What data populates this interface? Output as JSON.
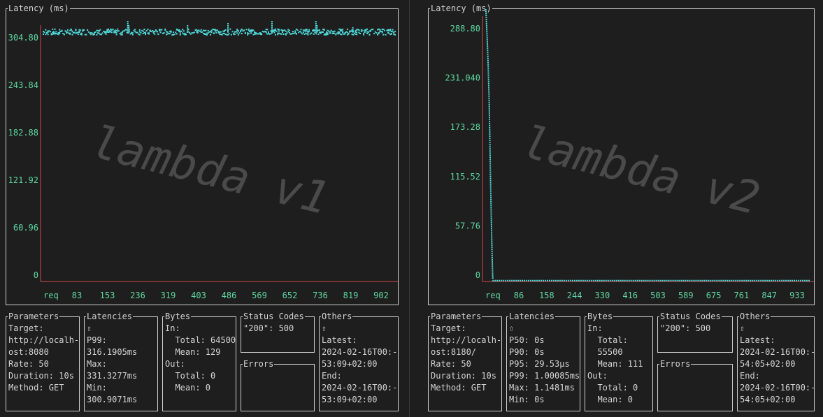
{
  "panels": [
    {
      "id": "left",
      "watermark": "lambda v1",
      "chart_title": "Latency (ms)",
      "chart_data": {
        "type": "scatter",
        "title": "Latency (ms)",
        "xlabel": "req",
        "x_ticks": [
          "83",
          "153",
          "236",
          "319",
          "403",
          "486",
          "569",
          "652",
          "736",
          "819",
          "902"
        ],
        "y_ticks": [
          "304.80",
          "243.84",
          "182.88",
          "121.92",
          "60.96",
          "0"
        ],
        "ylim": [
          0,
          304.8
        ],
        "xlim": [
          0,
          1000
        ],
        "series": [
          {
            "type": "band",
            "x_range": [
              0,
              1000
            ],
            "y_base": 305.0,
            "y_spread": 3.5,
            "spikes": [
              {
                "x": 240,
                "y": 318
              },
              {
                "x": 243,
                "y": 313
              },
              {
                "x": 410,
                "y": 314
              },
              {
                "x": 525,
                "y": 316
              },
              {
                "x": 650,
                "y": 318
              },
              {
                "x": 775,
                "y": 318
              },
              {
                "x": 778,
                "y": 314
              },
              {
                "x": 880,
                "y": 310
              }
            ]
          }
        ],
        "grid": false,
        "colors": {
          "points": "#4fd8d8",
          "ticks": "#5fd7a0",
          "axis": "#d24a4a",
          "frame": "#cfcfcf"
        }
      },
      "parameters": {
        "title": "Parameters",
        "lines": [
          "Target:",
          "http://localh-",
          "ost:8080",
          "Rate: 50",
          "Duration: 10s",
          "Method: GET"
        ]
      },
      "latencies": {
        "title": "Latencies",
        "lines": [
          "⇧",
          "P99:",
          "316.1905ms",
          "Max:",
          "331.3277ms",
          "Min:",
          "300.9071ms"
        ]
      },
      "bytes": {
        "title": "Bytes",
        "lines": [
          "In:",
          "  Total: 64500",
          "  Mean: 129",
          "Out:",
          "  Total: 0",
          "  Mean: 0"
        ]
      },
      "status_codes": {
        "title": "Status Codes",
        "lines": [
          "\"200\": 500"
        ]
      },
      "errors": {
        "title": "Errors",
        "lines": []
      },
      "others": {
        "title": "Others",
        "lines": [
          "⇧",
          "Latest:",
          "2024-02-16T00:-",
          "53:09+02:00",
          "End:",
          "2024-02-16T00:-",
          "53:09+02:00"
        ]
      }
    },
    {
      "id": "right",
      "watermark": "lambda v2",
      "chart_title": "Latency (ms)",
      "chart_data": {
        "type": "scatter",
        "title": "Latency (ms)",
        "xlabel": "req",
        "x_ticks": [
          "86",
          "158",
          "244",
          "330",
          "416",
          "503",
          "589",
          "675",
          "761",
          "847",
          "933"
        ],
        "y_ticks": [
          "288.80",
          "231.040",
          "173.28",
          "115.52",
          "57.76",
          "0"
        ],
        "ylim": [
          0,
          288.8
        ],
        "xlim": [
          0,
          1000
        ],
        "series": [
          {
            "type": "curve",
            "points": [
              [
                0,
                318
              ],
              [
                3,
                295
              ],
              [
                6,
                270
              ],
              [
                9,
                240
              ],
              [
                12,
                200
              ],
              [
                14,
                160
              ],
              [
                16,
                115
              ],
              [
                18,
                80
              ],
              [
                20,
                45
              ],
              [
                22,
                15
              ],
              [
                23,
                4
              ],
              [
                24,
                1.0
              ],
              [
                1000,
                1.0
              ]
            ]
          }
        ],
        "grid": false,
        "colors": {
          "points": "#4fd8d8",
          "ticks": "#5fd7a0",
          "axis": "#d24a4a",
          "frame": "#cfcfcf"
        }
      },
      "parameters": {
        "title": "Parameters",
        "lines": [
          "Target:",
          "http://localh-",
          "ost:8180/",
          "Rate: 50",
          "Duration: 10s",
          "Method: GET"
        ]
      },
      "latencies": {
        "title": "Latencies",
        "lines": [
          "⇧",
          "P50: 0s",
          "P90: 0s",
          "P95: 29.53µs",
          "P99: 1.00085ms",
          "Max: 1.1481ms",
          "Min: 0s"
        ]
      },
      "bytes": {
        "title": "Bytes",
        "lines": [
          "In:",
          "  Total:",
          "  55500",
          "  Mean: 111",
          "Out:",
          "  Total: 0",
          "  Mean: 0"
        ]
      },
      "status_codes": {
        "title": "Status Codes",
        "lines": [
          "\"200\": 500"
        ]
      },
      "errors": {
        "title": "Errors",
        "lines": []
      },
      "others": {
        "title": "Others",
        "lines": [
          "⇧",
          "Latest:",
          "2024-02-16T00:-",
          "54:05+02:00",
          "End:",
          "2024-02-16T00:-",
          "54:05+02:00"
        ]
      }
    }
  ]
}
